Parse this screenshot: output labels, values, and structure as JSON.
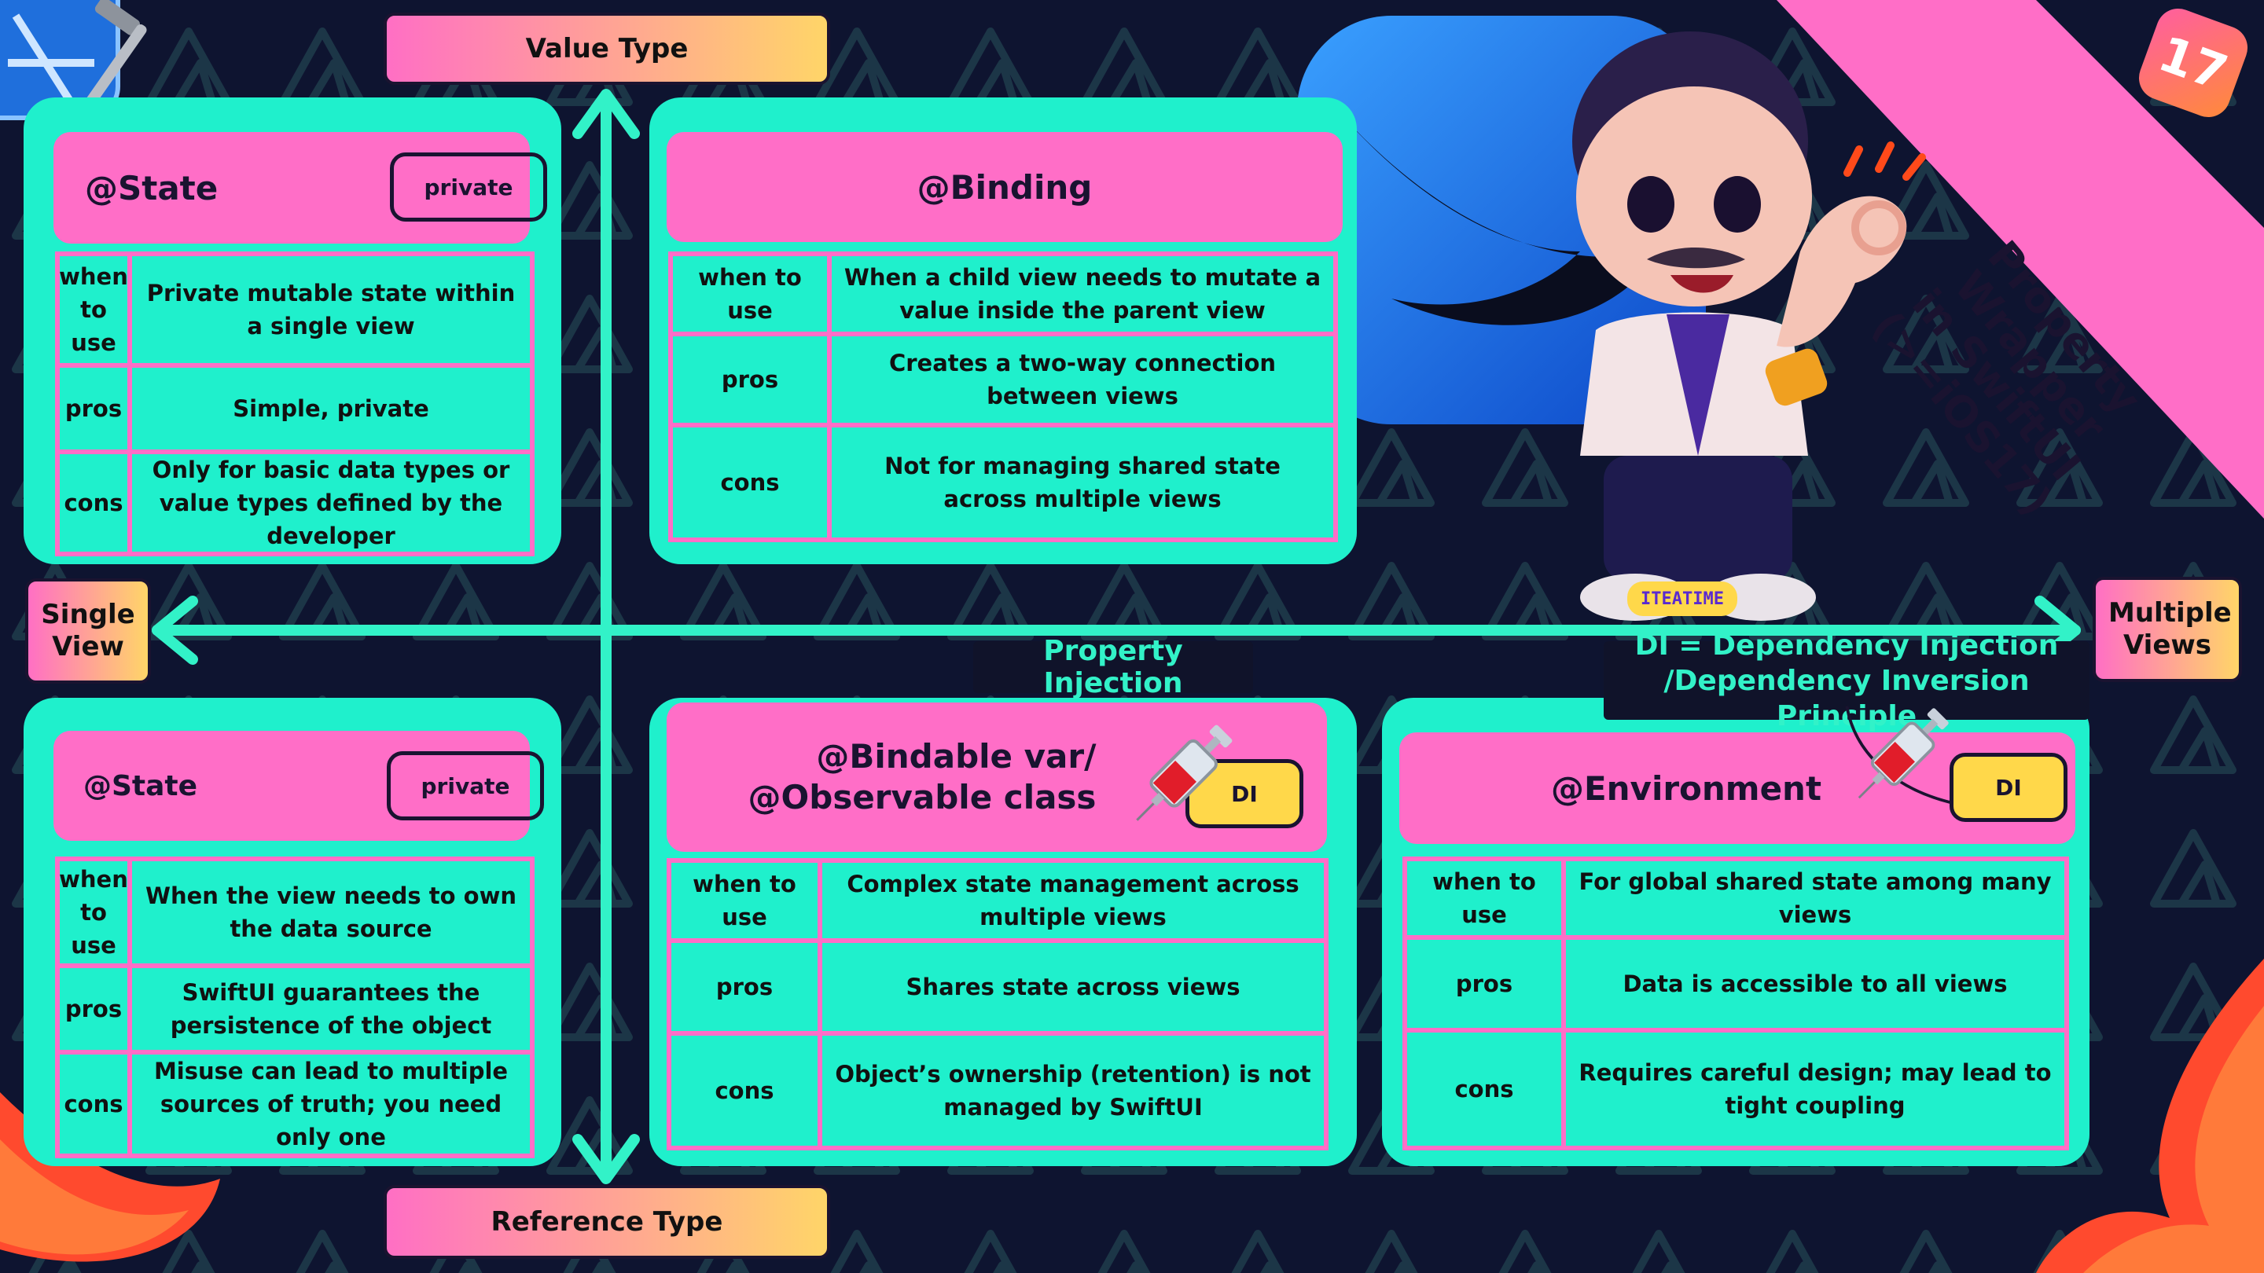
{
  "axes": {
    "top": "Value Type",
    "bottom": "Reference Type",
    "left": "Single View",
    "right": "Multiple Views"
  },
  "banner": {
    "title_lines": [
      "Property Wrapper",
      "in SwiftUI",
      "(>=iOS17)"
    ],
    "ios_badge": "17",
    "figure_tag": "ITEATIME"
  },
  "badges": {
    "property_injection": "Property Injection",
    "di_note_lines": [
      "DI = Dependency Injection",
      "/Dependency Inversion Principle"
    ]
  },
  "row_labels": {
    "when_to_use": "when to use",
    "when_to_use_stacked": [
      "when",
      "to",
      "use"
    ],
    "pros": "pros",
    "cons": "cons"
  },
  "cards": {
    "state_value": {
      "title": "@State",
      "tag": "private",
      "when_to_use": "Private mutable state within a single view",
      "pros": "Simple, private",
      "cons": "Only for basic data types or value types defined by the developer"
    },
    "binding": {
      "title": "@Binding",
      "when_to_use": "When a child view needs to mutate a value inside the parent view",
      "pros": "Creates a two-way connection between views",
      "cons": "Not for managing shared state across multiple views"
    },
    "state_reference": {
      "title": "@State",
      "tag": "private",
      "when_to_use": "When the view needs to own the data source",
      "pros": "SwiftUI guarantees the persistence of the object",
      "cons": "Misuse can lead to multiple sources of truth; you need only one"
    },
    "bindable": {
      "title_lines": [
        "@Bindable var/",
        "@Observable class"
      ],
      "tag": "DI",
      "when_to_use": "Complex state management across multiple views",
      "pros": "Shares state across views",
      "cons": "Object’s ownership (retention) is not managed by SwiftUI"
    },
    "environment": {
      "title": "@Environment",
      "tag": "DI",
      "when_to_use": "For global shared state among many views",
      "pros": "Data is accessible to all views",
      "cons": "Requires careful design; may lead to tight coupling"
    }
  },
  "colors": {
    "background": "#0e1430",
    "card": "#1ff0cc",
    "header": "#ff6ec7",
    "axis": "#32f2c8",
    "pill_gradient": [
      "#ff6fc4",
      "#ffd568"
    ],
    "di_tag": "#ffd84a",
    "banner": "#ff6ec7"
  },
  "icons": [
    "hammer-icon",
    "xcode-icon",
    "swift-logo-icon",
    "syringe-icon",
    "vinyl-figure-icon",
    "ios17-icon"
  ]
}
